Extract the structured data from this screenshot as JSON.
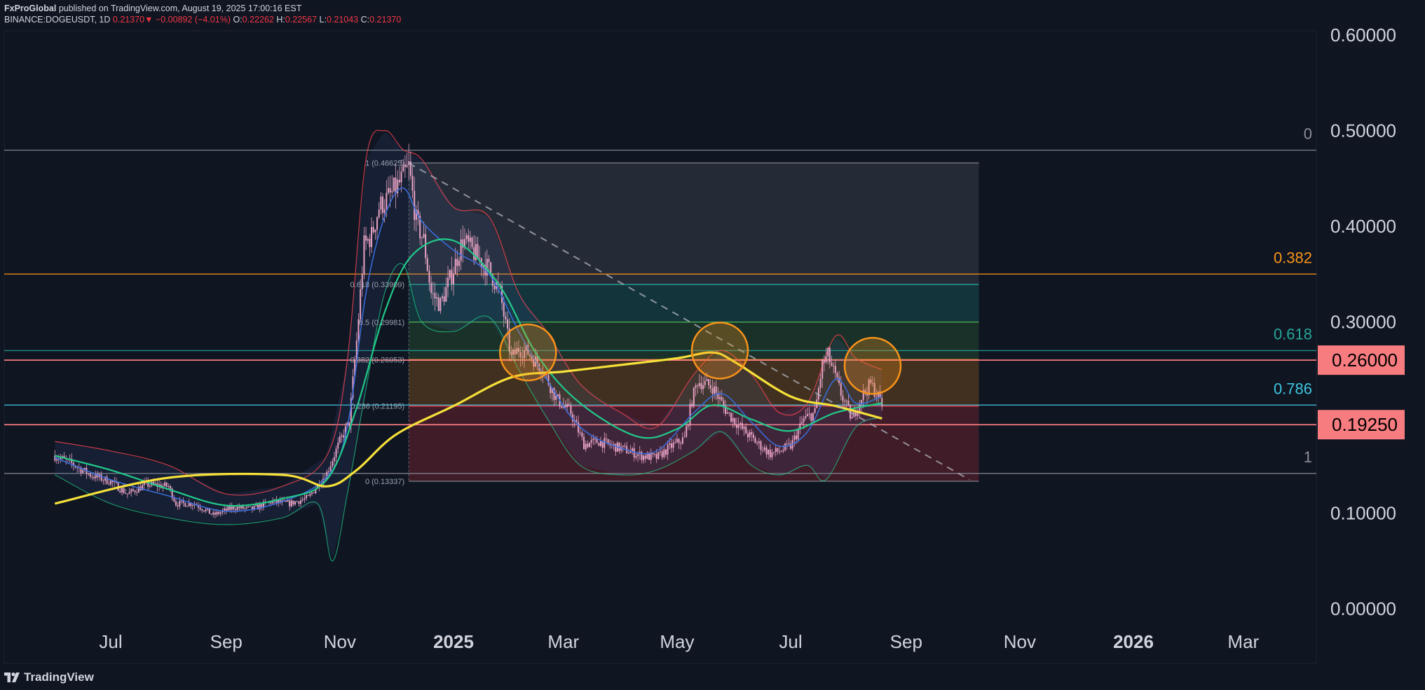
{
  "header": {
    "publisher": "FxProGlobal",
    "published": "published on TradingView.com, August 19, 2025 17:00:16 EST",
    "symbol": "BINANCE:DOGEUSDT, 1D",
    "last": "0.21370",
    "change_arrow": "▼",
    "change": "−0.00892 (−4.01%)",
    "o_label": "O:",
    "o": "0.22262",
    "h_label": "H:",
    "h": "0.22567",
    "l_label": "L:",
    "l": "0.21043",
    "c_label": "C:",
    "c": "0.21370"
  },
  "footer": {
    "brand": "TradingView"
  },
  "colors": {
    "background": "#0f1521",
    "candle": "#e8a3c4",
    "ma200": "#f5e03a",
    "ma_green": "#22c98a",
    "ma_blue": "#3a6fe0",
    "bb": "#e8424f",
    "orange": "#f7931a",
    "teal": "#26a69a",
    "cyan": "#3ec6e0",
    "pink_box": "#f77c80"
  },
  "chart_data": {
    "type": "candlestick",
    "symbol": "BINANCE:DOGEUSDT",
    "timeframe": "1D",
    "ylim": [
      0.0,
      0.6
    ],
    "y_ticks": [
      {
        "value": 0.6,
        "label": "0.60000"
      },
      {
        "value": 0.5,
        "label": "0.50000"
      },
      {
        "value": 0.4,
        "label": "0.40000"
      },
      {
        "value": 0.3,
        "label": "0.30000"
      },
      {
        "value": 0.1,
        "label": "0.10000"
      },
      {
        "value": 0.0,
        "label": "0.00000"
      }
    ],
    "x_ticks": [
      {
        "label": "Jul",
        "date": "2024-07-01",
        "bold": false
      },
      {
        "label": "Sep",
        "date": "2024-09-01",
        "bold": false
      },
      {
        "label": "Nov",
        "date": "2024-11-01",
        "bold": false
      },
      {
        "label": "2025",
        "date": "2025-01-01",
        "bold": true
      },
      {
        "label": "Mar",
        "date": "2025-03-01",
        "bold": false
      },
      {
        "label": "May",
        "date": "2025-05-01",
        "bold": false
      },
      {
        "label": "Jul",
        "date": "2025-07-01",
        "bold": false
      },
      {
        "label": "Sep",
        "date": "2025-09-01",
        "bold": false
      },
      {
        "label": "Nov",
        "date": "2025-11-01",
        "bold": false
      },
      {
        "label": "2026",
        "date": "2026-01-01",
        "bold": true
      },
      {
        "label": "Mar",
        "date": "2026-03-01",
        "bold": false
      }
    ],
    "price_boxes": [
      {
        "value": 0.26,
        "label": "0.26000"
      },
      {
        "value": 0.1925,
        "label": "0.19250"
      }
    ],
    "fib_right": {
      "levels": [
        {
          "label": "0",
          "value": 0.4795,
          "color": "#8a8f99"
        },
        {
          "label": "0.382",
          "value": 0.35,
          "color": "#f7931a"
        },
        {
          "label": "0.618",
          "value": 0.27,
          "color": "#26a69a"
        },
        {
          "label": "0.786",
          "value": 0.213,
          "color": "#3ec6e0"
        },
        {
          "label": "1",
          "value": 0.1415,
          "color": "#8a8f99"
        }
      ]
    },
    "fib_retracement": {
      "start_date": "2024-12-08",
      "end_date": "2025-10-10",
      "levels": [
        {
          "ratio": "1",
          "value": 0.46625,
          "label": "1 (0.46625)",
          "color": "#787b86"
        },
        {
          "ratio": "0.618",
          "value": 0.33909,
          "label": "0.618 (0.33909)",
          "color": "#26a69a"
        },
        {
          "ratio": "0.5",
          "value": 0.29981,
          "label": "0.5 (0.29981)",
          "color": "#4caf50"
        },
        {
          "ratio": "0.382",
          "value": 0.26053,
          "label": "0.382 (0.26053)",
          "color": "#f7931a"
        },
        {
          "ratio": "0.236",
          "value": 0.21195,
          "label": "0.236 (0.21195)",
          "color": "#f23645"
        },
        {
          "ratio": "0",
          "value": 0.13337,
          "label": "0 (0.13337)",
          "color": "#787b86"
        }
      ]
    },
    "trendline": {
      "points": [
        [
          "2024-12-08",
          0.466
        ],
        [
          "2025-10-05",
          0.135
        ]
      ]
    },
    "highlight_circles": [
      {
        "date": "2025-02-10",
        "value": 0.268
      },
      {
        "date": "2025-05-24",
        "value": 0.27
      },
      {
        "date": "2025-08-14",
        "value": 0.254
      }
    ],
    "close_series": {
      "dates": [
        "2024-06-01",
        "2024-06-10",
        "2024-06-20",
        "2024-07-01",
        "2024-07-10",
        "2024-07-20",
        "2024-08-01",
        "2024-08-05",
        "2024-08-15",
        "2024-08-25",
        "2024-09-05",
        "2024-09-15",
        "2024-09-25",
        "2024-10-05",
        "2024-10-15",
        "2024-10-25",
        "2024-11-01",
        "2024-11-06",
        "2024-11-10",
        "2024-11-14",
        "2024-11-18",
        "2024-11-22",
        "2024-11-28",
        "2024-12-03",
        "2024-12-08",
        "2024-12-12",
        "2024-12-16",
        "2024-12-20",
        "2024-12-25",
        "2025-01-01",
        "2025-01-06",
        "2025-01-12",
        "2025-01-20",
        "2025-01-26",
        "2025-02-01",
        "2025-02-05",
        "2025-02-10",
        "2025-02-18",
        "2025-02-25",
        "2025-03-05",
        "2025-03-12",
        "2025-03-20",
        "2025-03-28",
        "2025-04-05",
        "2025-04-12",
        "2025-04-20",
        "2025-04-28",
        "2025-05-05",
        "2025-05-09",
        "2025-05-12",
        "2025-05-20",
        "2025-05-28",
        "2025-06-05",
        "2025-06-12",
        "2025-06-20",
        "2025-06-25",
        "2025-07-01",
        "2025-07-08",
        "2025-07-14",
        "2025-07-18",
        "2025-07-21",
        "2025-07-28",
        "2025-08-03",
        "2025-08-08",
        "2025-08-13",
        "2025-08-17",
        "2025-08-19"
      ],
      "values": [
        0.16,
        0.152,
        0.14,
        0.133,
        0.12,
        0.13,
        0.128,
        0.11,
        0.11,
        0.098,
        0.106,
        0.104,
        0.112,
        0.11,
        0.116,
        0.142,
        0.175,
        0.195,
        0.28,
        0.38,
        0.39,
        0.42,
        0.432,
        0.445,
        0.462,
        0.405,
        0.385,
        0.33,
        0.318,
        0.355,
        0.386,
        0.372,
        0.355,
        0.33,
        0.262,
        0.272,
        0.268,
        0.25,
        0.22,
        0.205,
        0.172,
        0.175,
        0.17,
        0.165,
        0.16,
        0.158,
        0.17,
        0.178,
        0.218,
        0.238,
        0.232,
        0.205,
        0.188,
        0.175,
        0.162,
        0.165,
        0.17,
        0.198,
        0.205,
        0.255,
        0.265,
        0.225,
        0.198,
        0.222,
        0.235,
        0.222,
        0.2137
      ]
    },
    "ma200_series": {
      "dates": [
        "2024-06-01",
        "2024-08-01",
        "2024-10-01",
        "2024-10-25",
        "2024-11-10",
        "2024-12-01",
        "2025-01-01",
        "2025-02-01",
        "2025-03-01",
        "2025-04-01",
        "2025-05-01",
        "2025-05-20",
        "2025-06-01",
        "2025-07-01",
        "2025-07-25",
        "2025-08-19"
      ],
      "values": [
        0.11,
        0.137,
        0.14,
        0.128,
        0.145,
        0.182,
        0.212,
        0.242,
        0.248,
        0.255,
        0.262,
        0.268,
        0.258,
        0.222,
        0.212,
        0.199
      ]
    },
    "ma_green_series": {
      "dates": [
        "2024-06-01",
        "2024-07-01",
        "2024-08-01",
        "2024-09-01",
        "2024-10-01",
        "2024-10-25",
        "2024-11-10",
        "2024-11-25",
        "2024-12-10",
        "2025-01-01",
        "2025-01-25",
        "2025-02-15",
        "2025-03-10",
        "2025-04-10",
        "2025-05-01",
        "2025-05-20",
        "2025-06-10",
        "2025-07-01",
        "2025-07-25",
        "2025-08-19"
      ],
      "values": [
        0.16,
        0.145,
        0.125,
        0.108,
        0.115,
        0.135,
        0.21,
        0.31,
        0.37,
        0.385,
        0.34,
        0.265,
        0.215,
        0.18,
        0.188,
        0.213,
        0.198,
        0.186,
        0.205,
        0.215
      ]
    },
    "ma_blue_series": {
      "dates": [
        "2024-06-01",
        "2024-07-01",
        "2024-08-01",
        "2024-09-01",
        "2024-10-01",
        "2024-10-25",
        "2024-11-05",
        "2024-11-15",
        "2024-11-25",
        "2024-12-05",
        "2024-12-15",
        "2025-01-01",
        "2025-01-20",
        "2025-02-05",
        "2025-02-20",
        "2025-03-10",
        "2025-04-01",
        "2025-04-20",
        "2025-05-10",
        "2025-05-25",
        "2025-06-10",
        "2025-06-25",
        "2025-07-10",
        "2025-07-25",
        "2025-08-05",
        "2025-08-19"
      ],
      "values": [
        0.158,
        0.135,
        0.118,
        0.102,
        0.112,
        0.138,
        0.19,
        0.33,
        0.41,
        0.44,
        0.405,
        0.375,
        0.35,
        0.29,
        0.24,
        0.19,
        0.168,
        0.165,
        0.205,
        0.225,
        0.195,
        0.17,
        0.185,
        0.24,
        0.215,
        0.222
      ]
    },
    "bb_upper_series": {
      "dates": [
        "2024-06-01",
        "2024-07-01",
        "2024-08-01",
        "2024-09-01",
        "2024-10-01",
        "2024-10-25",
        "2024-11-05",
        "2024-11-15",
        "2024-11-25",
        "2024-12-05",
        "2024-12-15",
        "2025-01-01",
        "2025-01-20",
        "2025-02-05",
        "2025-02-20",
        "2025-03-10",
        "2025-04-01",
        "2025-04-20",
        "2025-05-10",
        "2025-05-25",
        "2025-06-10",
        "2025-06-25",
        "2025-07-10",
        "2025-07-25",
        "2025-08-05",
        "2025-08-19"
      ],
      "values": [
        0.175,
        0.165,
        0.15,
        0.12,
        0.128,
        0.16,
        0.26,
        0.47,
        0.5,
        0.48,
        0.47,
        0.42,
        0.41,
        0.33,
        0.29,
        0.235,
        0.205,
        0.19,
        0.245,
        0.27,
        0.245,
        0.205,
        0.215,
        0.285,
        0.262,
        0.25
      ]
    },
    "bb_lower_series": {
      "dates": [
        "2024-06-01",
        "2024-07-01",
        "2024-08-01",
        "2024-09-01",
        "2024-10-01",
        "2024-10-20",
        "2024-10-28",
        "2024-11-05",
        "2024-11-15",
        "2024-11-25",
        "2024-12-05",
        "2024-12-15",
        "2025-01-01",
        "2025-01-20",
        "2025-02-05",
        "2025-02-20",
        "2025-03-10",
        "2025-04-01",
        "2025-04-20",
        "2025-05-10",
        "2025-05-25",
        "2025-06-10",
        "2025-06-25",
        "2025-07-10",
        "2025-07-20",
        "2025-08-05",
        "2025-08-19"
      ],
      "values": [
        0.14,
        0.11,
        0.095,
        0.088,
        0.095,
        0.11,
        0.05,
        0.12,
        0.23,
        0.33,
        0.36,
        0.3,
        0.29,
        0.305,
        0.25,
        0.2,
        0.15,
        0.14,
        0.145,
        0.165,
        0.185,
        0.15,
        0.14,
        0.15,
        0.135,
        0.19,
        0.2
      ]
    }
  }
}
